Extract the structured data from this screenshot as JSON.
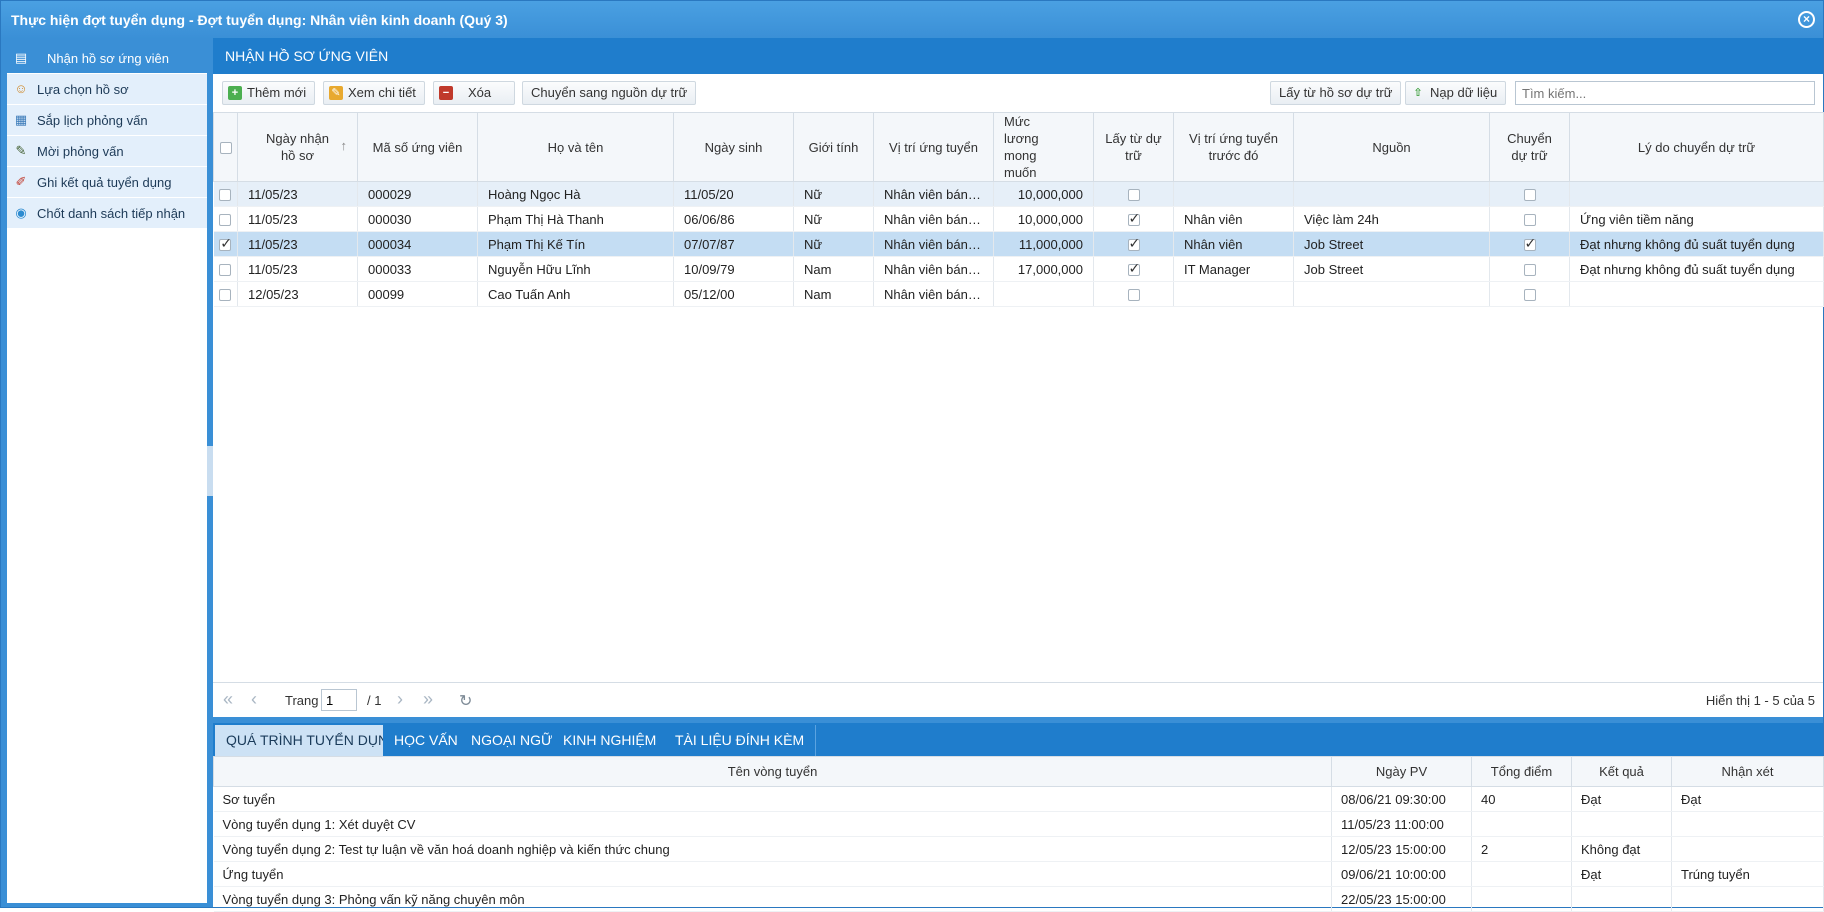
{
  "window": {
    "title": "Thực hiện đợt tuyển dụng - Đợt tuyển dụng: Nhân viên kinh doanh (Quý 3)",
    "close_icon": "close-circle-icon"
  },
  "sidebar": {
    "items": [
      {
        "label": "Nhận hồ sơ ứng viên",
        "icon": "inbox-icon",
        "active": true
      },
      {
        "label": "Lựa chọn hồ sơ",
        "icon": "select-profile-icon"
      },
      {
        "label": "Sắp lịch phỏng vấn",
        "icon": "schedule-icon"
      },
      {
        "label": "Mời phỏng vấn",
        "icon": "invite-icon"
      },
      {
        "label": "Ghi kết quả tuyển dụng",
        "icon": "record-result-icon"
      },
      {
        "label": "Chốt danh sách tiếp nhận",
        "icon": "finalize-list-icon"
      }
    ]
  },
  "panel": {
    "title": "NHẬN HỒ SƠ ỨNG VIÊN"
  },
  "toolbar": {
    "add_label": "Thêm mới",
    "view_label": "Xem chi tiết",
    "delete_label": "Xóa",
    "move_label": "Chuyển sang nguồn dự trữ",
    "get_reserve_label": "Lấy từ hồ sơ dự trữ",
    "load_label": "Nạp dữ liệu",
    "search_placeholder": "Tìm kiếm..."
  },
  "grid": {
    "columns": [
      "Ngày nhận hồ sơ",
      "Mã số ứng viên",
      "Họ và tên",
      "Ngày sinh",
      "Giới tính",
      "Vị trí ứng tuyển",
      "Mức lương mong muốn",
      "Lấy từ dự trữ",
      "Vị trí ứng tuyển trước đó",
      "Nguồn",
      "Chuyển dự trữ",
      "Lý do chuyển dự trữ"
    ],
    "sort_icon": "sort-up-icon",
    "rows": [
      {
        "checked": false,
        "date": "11/05/23",
        "code": "000029",
        "name": "Hoàng Ngọc Hà",
        "dob": "11/05/20",
        "gender": "Nữ",
        "position": "Nhân viên bán hàng",
        "salary": "10,000,000",
        "from_reserve": false,
        "prev_position": "",
        "source": "",
        "to_reserve": false,
        "reason": ""
      },
      {
        "checked": false,
        "date": "11/05/23",
        "code": "000030",
        "name": "Phạm Thị Hà Thanh",
        "dob": "06/06/86",
        "gender": "Nữ",
        "position": "Nhân viên bán hàng",
        "salary": "10,000,000",
        "from_reserve": true,
        "prev_position": "Nhân viên",
        "source": "Việc làm 24h",
        "to_reserve": false,
        "reason": "Ứng viên tiềm năng"
      },
      {
        "checked": true,
        "date": "11/05/23",
        "code": "000034",
        "name": "Phạm Thị Kế Tín",
        "dob": "07/07/87",
        "gender": "Nữ",
        "position": "Nhân viên bán hàng",
        "salary": "11,000,000",
        "from_reserve": true,
        "prev_position": "Nhân viên",
        "source": "Job Street",
        "to_reserve": true,
        "reason": "Đạt nhưng không đủ suất tuyển dụng"
      },
      {
        "checked": false,
        "date": "11/05/23",
        "code": "000033",
        "name": "Nguyễn Hữu Lĩnh",
        "dob": "10/09/79",
        "gender": "Nam",
        "position": "Nhân viên bán hàng",
        "salary": "17,000,000",
        "from_reserve": true,
        "prev_position": "IT Manager",
        "source": "Job Street",
        "to_reserve": false,
        "reason": "Đạt nhưng không đủ suất tuyển dụng"
      },
      {
        "checked": false,
        "date": "12/05/23",
        "code": "00099",
        "name": "Cao Tuấn Anh",
        "dob": "05/12/00",
        "gender": "Nam",
        "position": "Nhân viên bán hàng",
        "salary": "",
        "from_reserve": false,
        "prev_position": "",
        "source": "",
        "to_reserve": false,
        "reason": ""
      }
    ]
  },
  "pager": {
    "page_label": "Trang",
    "page_value": "1",
    "total_pages": "/ 1",
    "summary": "Hiển thị 1 - 5 của 5"
  },
  "tabs": [
    "QUÁ TRÌNH TUYỂN DỤNG",
    "HỌC VẤN",
    "NGOẠI NGỮ",
    "KINH NGHIỆM",
    "TÀI LIỆU ĐÍNH KÈM"
  ],
  "process": {
    "columns": [
      "Tên vòng tuyển",
      "Ngày PV",
      "Tổng điểm",
      "Kết quả",
      "Nhận xét"
    ],
    "rows": [
      {
        "round": "Sơ tuyển",
        "date": "08/06/21 09:30:00",
        "score": "40",
        "result": "Đạt",
        "comment": "Đạt"
      },
      {
        "round": "Vòng tuyển dụng 1: Xét duyệt CV",
        "date": "11/05/23 11:00:00",
        "score": "",
        "result": "",
        "comment": ""
      },
      {
        "round": "Vòng tuyển dụng 2: Test tự luận về văn hoá doanh nghiệp và kiến thức chung",
        "date": "12/05/23 15:00:00",
        "score": "2",
        "result": "Không đạt",
        "comment": ""
      },
      {
        "round": "Ứng tuyển",
        "date": "09/06/21 10:00:00",
        "score": "",
        "result": "Đạt",
        "comment": "Trúng tuyển"
      },
      {
        "round": "Vòng tuyển dụng 3: Phỏng vấn kỹ năng chuyên môn",
        "date": "22/05/23 15:00:00",
        "score": "",
        "result": "",
        "comment": ""
      }
    ]
  }
}
